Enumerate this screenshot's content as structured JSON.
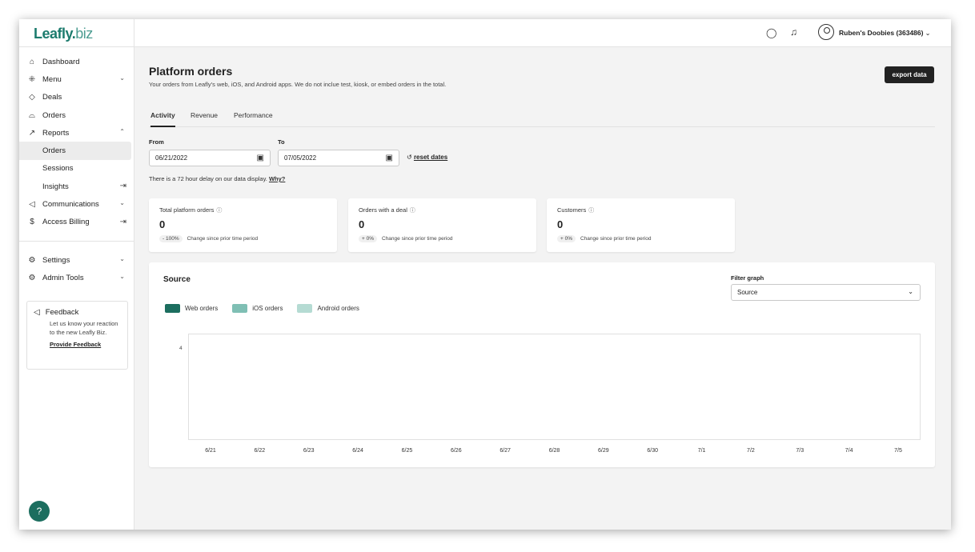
{
  "app": {
    "logo_main": "Leafly",
    "logo_dot": ".",
    "logo_biz": "biz"
  },
  "sidebar": {
    "items": [
      {
        "label": "Dashboard",
        "icon": "home-icon"
      },
      {
        "label": "Menu",
        "icon": "menu-grid-icon"
      },
      {
        "label": "Deals",
        "icon": "tag-icon"
      },
      {
        "label": "Orders",
        "icon": "shopping-bag-icon"
      },
      {
        "label": "Reports",
        "icon": "trend-icon"
      },
      {
        "label": "Orders",
        "icon": ""
      },
      {
        "label": "Sessions",
        "icon": ""
      },
      {
        "label": "Insights",
        "icon": "external-link-icon"
      },
      {
        "label": "Communications",
        "icon": "megaphone-icon"
      },
      {
        "label": "Access Billing",
        "icon": "billing-icon"
      },
      {
        "label": "Settings",
        "icon": "gear-icon"
      },
      {
        "label": "Admin Tools",
        "icon": "gear-icon"
      }
    ],
    "feedback": {
      "title": "Feedback",
      "text": "Let us know your reaction to the new Leafly Biz.",
      "link": "Provide Feedback"
    }
  },
  "topbar": {
    "user": "Ruben's Doobies (363486)"
  },
  "page": {
    "title": "Platform orders",
    "subtitle": "Your orders from Leafly's web, iOS, and Android apps. We do not inclue test, kiosk, or embed orders in the total.",
    "export_label": "export data"
  },
  "tabs": [
    "Activity",
    "Revenue",
    "Performance"
  ],
  "dates": {
    "from_label": "From",
    "from_value": "06/21/2022",
    "to_label": "To",
    "to_value": "07/05/2022",
    "reset_label": "reset dates",
    "delay_text": "There is a 72 hour delay on our data display.",
    "why_label": "Why?"
  },
  "cards": [
    {
      "title": "Total platform orders",
      "value": "0",
      "badge": "- 100%",
      "change": "Change since prior time period"
    },
    {
      "title": "Orders with a deal",
      "value": "0",
      "badge": "+ 0%",
      "change": "Change since prior time period"
    },
    {
      "title": "Customers",
      "value": "0",
      "badge": "+ 0%",
      "change": "Change since prior time period"
    }
  ],
  "source": {
    "title": "Source",
    "filter_label": "Filter graph",
    "filter_value": "Source"
  },
  "chart_data": {
    "type": "bar",
    "title": "Source",
    "categories": [
      "6/21",
      "6/22",
      "6/23",
      "6/24",
      "6/25",
      "6/26",
      "6/27",
      "6/28",
      "6/29",
      "6/30",
      "7/1",
      "7/2",
      "7/3",
      "7/4",
      "7/5"
    ],
    "series": [
      {
        "name": "Web orders",
        "color": "#1c6e5f",
        "values": [
          0,
          0,
          0,
          0,
          0,
          0,
          0,
          0,
          0,
          0,
          0,
          0,
          0,
          0,
          0
        ]
      },
      {
        "name": "iOS orders",
        "color": "#7fbfb4",
        "values": [
          0,
          0,
          0,
          0,
          0,
          0,
          0,
          0,
          0,
          0,
          0,
          0,
          0,
          0,
          0
        ]
      },
      {
        "name": "Android orders",
        "color": "#b5dbd3",
        "values": [
          0,
          0,
          0,
          0,
          0,
          0,
          0,
          0,
          0,
          0,
          0,
          0,
          0,
          0,
          0
        ]
      }
    ],
    "yticks": [
      "4"
    ],
    "legend": "top-left"
  }
}
